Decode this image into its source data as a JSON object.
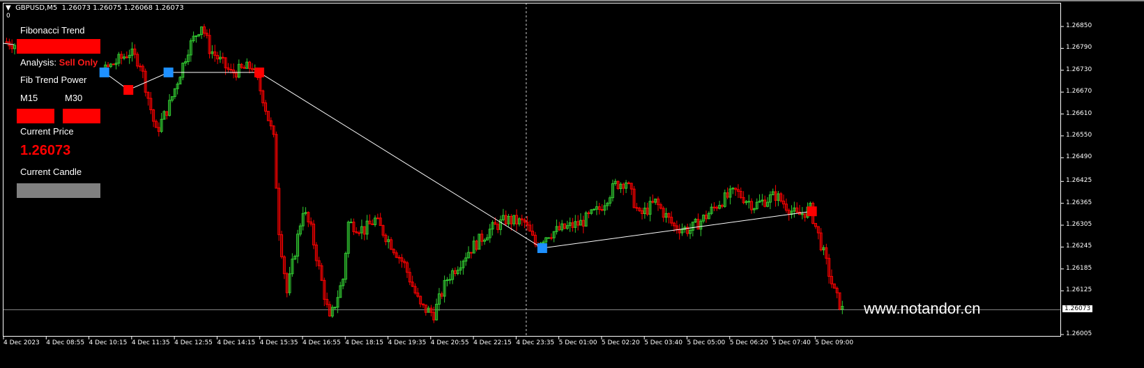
{
  "header": {
    "symbol": "GBPUSD,M5",
    "ohlc": "1.26073 1.26075 1.26068 1.26073",
    "subwindow_value": "0"
  },
  "panel": {
    "title": "Fibonacci Trend",
    "analysis_label": "Analysis:",
    "analysis_value": "Sell Only",
    "power_label": "Fib Trend Power",
    "m15_label": "M15",
    "m30_label": "M30",
    "current_price_label": "Current Price",
    "current_price": "1.26073",
    "current_candle_label": "Current Candle",
    "colors": {
      "trend": "#ff0000",
      "m15": "#ff0000",
      "m30": "#ff0000",
      "candle": "#808080"
    }
  },
  "watermark": "www.notandor.cn",
  "chart_data": {
    "type": "candlestick",
    "colors": {
      "up": "#32cd32",
      "down": "#ff0000",
      "zigzag": "#ffffff",
      "high_marker": "#ff0000",
      "low_marker": "#1e90ff"
    },
    "ylim": [
      1.25985,
      1.26875
    ],
    "current_price": "1.26073",
    "price_ticks": [
      "1.26850",
      "1.26790",
      "1.26730",
      "1.26670",
      "1.26610",
      "1.26550",
      "1.26490",
      "1.26425",
      "1.26365",
      "1.26305",
      "1.26245",
      "1.26185",
      "1.26125",
      "1.26005"
    ],
    "time_ticks": [
      "4 Dec 2023",
      "4 Dec 08:55",
      "4 Dec 10:15",
      "4 Dec 11:35",
      "4 Dec 12:55",
      "4 Dec 14:15",
      "4 Dec 15:35",
      "4 Dec 16:55",
      "4 Dec 18:15",
      "4 Dec 19:35",
      "4 Dec 20:55",
      "4 Dec 22:15",
      "4 Dec 23:35",
      "5 Dec 01:00",
      "5 Dec 02:20",
      "5 Dec 03:40",
      "5 Dec 05:00",
      "5 Dec 06:20",
      "5 Dec 07:40",
      "5 Dec 09:00"
    ],
    "candles_per_tick": 16,
    "price_path": [
      [
        0,
        1.26808
      ],
      [
        37,
        1.26731
      ],
      [
        46,
        1.26779
      ],
      [
        50,
        1.26751
      ],
      [
        56,
        1.26559
      ],
      [
        61,
        1.26636
      ],
      [
        68,
        1.26789
      ],
      [
        73,
        1.26856
      ],
      [
        76,
        1.26789
      ],
      [
        84,
        1.26722
      ],
      [
        92,
        1.26741
      ],
      [
        96,
        1.26655
      ],
      [
        100,
        1.2654
      ],
      [
        102,
        1.26292
      ],
      [
        105,
        1.2612
      ],
      [
        111,
        1.26349
      ],
      [
        114,
        1.26292
      ],
      [
        121,
        1.26043
      ],
      [
        126,
        1.26158
      ],
      [
        128,
        1.26311
      ],
      [
        134,
        1.26292
      ],
      [
        138,
        1.2632
      ],
      [
        144,
        1.26253
      ],
      [
        149,
        1.26196
      ],
      [
        155,
        1.26081
      ],
      [
        160,
        1.26062
      ],
      [
        165,
        1.26158
      ],
      [
        173,
        1.26234
      ],
      [
        181,
        1.26292
      ],
      [
        187,
        1.2632
      ],
      [
        194,
        1.26311
      ],
      [
        198,
        1.26253
      ],
      [
        203,
        1.26282
      ],
      [
        207,
        1.26292
      ],
      [
        215,
        1.26311
      ],
      [
        222,
        1.26349
      ],
      [
        228,
        1.26416
      ],
      [
        232,
        1.26426
      ],
      [
        237,
        1.2633
      ],
      [
        243,
        1.26368
      ],
      [
        250,
        1.26301
      ],
      [
        256,
        1.26292
      ],
      [
        262,
        1.2633
      ],
      [
        267,
        1.26368
      ],
      [
        273,
        1.26397
      ],
      [
        280,
        1.26359
      ],
      [
        288,
        1.26387
      ],
      [
        296,
        1.2633
      ],
      [
        301,
        1.26349
      ],
      [
        305,
        1.26253
      ],
      [
        310,
        1.2612
      ],
      [
        313,
        1.26073
      ]
    ],
    "zigzag": [
      [
        37,
        1.26724,
        "low"
      ],
      [
        46,
        1.26676,
        "high"
      ],
      [
        61,
        1.26724,
        "low"
      ],
      [
        95,
        1.26724,
        "high"
      ],
      [
        201,
        1.26242,
        "low"
      ],
      [
        302,
        1.26343,
        "high"
      ]
    ],
    "vline_index": 195
  }
}
